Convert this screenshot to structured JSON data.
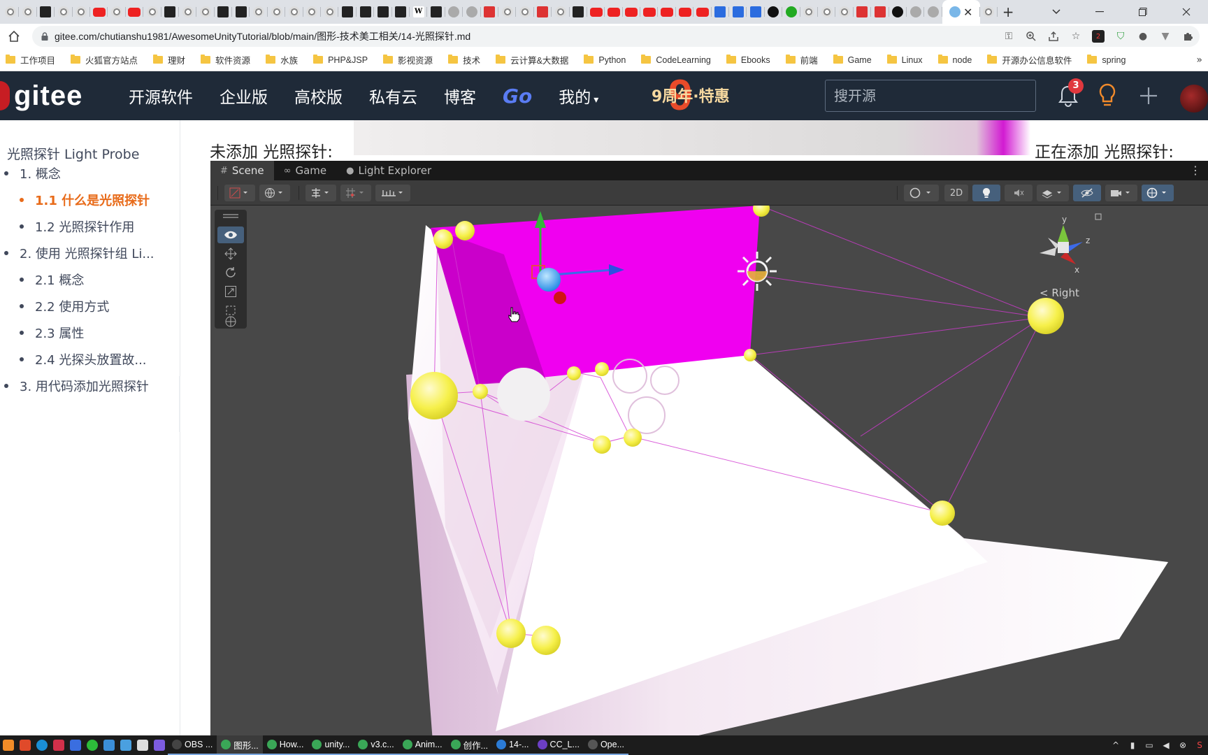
{
  "browser": {
    "active_tab_close": "✕",
    "new_tab": "+",
    "url": "gitee.com/chutianshu1981/AwesomeUnityTutorial/blob/main/图形-技术美工相关/14-光照探针.md",
    "tab_favicons": [
      "chrome",
      "chrome",
      "unity",
      "chrome",
      "chrome",
      "yt",
      "chrome",
      "yt",
      "chrome",
      "unity",
      "chrome",
      "chrome",
      "unity",
      "unity",
      "chrome",
      "chrome",
      "chrome",
      "chrome",
      "chrome",
      "unity",
      "unity",
      "unity",
      "unity",
      "w",
      "unity",
      "plain",
      "plain",
      "red",
      "chrome",
      "chrome",
      "red",
      "chrome",
      "unity",
      "yt",
      "yt",
      "yt",
      "yt",
      "yt",
      "yt",
      "yt",
      "blue",
      "blue",
      "blue",
      "gh",
      "green",
      "chrome",
      "chrome",
      "chrome",
      "red",
      "red",
      "gh",
      "plain",
      "plain"
    ],
    "bookmarks": [
      "工作项目",
      "火狐官方站点",
      "理财",
      "软件资源",
      "水族",
      "PHP&JSP",
      "影视资源",
      "技术",
      "云计算&大数据",
      "Python",
      "CodeLearning",
      "Ebooks",
      "前端",
      "Game",
      "Linux",
      "node",
      "开源办公信息软件",
      "spring"
    ],
    "bookmarks_more": "»"
  },
  "gitee": {
    "logo": "gitee",
    "nav": [
      {
        "label": "开源软件"
      },
      {
        "label": "企业版"
      },
      {
        "label": "高校版"
      },
      {
        "label": "私有云"
      },
      {
        "label": "博客"
      },
      {
        "label": "Go"
      },
      {
        "label": "我的"
      }
    ],
    "promo_text": "9周年·特惠",
    "promo_num": "9",
    "search_placeholder": "搜开源",
    "notifications_count": "3"
  },
  "toc": {
    "title": "光照探针 Light Probe",
    "items": [
      {
        "label": "1. 概念",
        "level": 1
      },
      {
        "label": "1.1 什么是光照探针",
        "level": 2,
        "active": true
      },
      {
        "label": "1.2 光照探针作用",
        "level": 2
      },
      {
        "label": "2. 使用 光照探针组 Li...",
        "level": 1
      },
      {
        "label": "2.1 概念",
        "level": 2
      },
      {
        "label": "2.2 使用方式",
        "level": 2
      },
      {
        "label": "2.3 属性",
        "level": 2
      },
      {
        "label": "2.4 光探头放置故...",
        "level": 2
      },
      {
        "label": "3. 用代码添加光照探针",
        "level": 1
      }
    ],
    "collapse": "‹"
  },
  "content": {
    "caption_left": "未添加 光照探针:",
    "caption_right": "正在添加 光照探针:"
  },
  "unity": {
    "tabs": [
      {
        "label": "Scene",
        "icon": "#"
      },
      {
        "label": "Game",
        "icon": "∞"
      },
      {
        "label": "Light Explorer",
        "icon": "●"
      }
    ],
    "kebab": "⋮",
    "btn_2d": "2D",
    "gizmo_label": "< Right",
    "axis_y": "y",
    "axis_z": "z",
    "axis_x": "x"
  },
  "taskbar": {
    "windows": [
      {
        "label": "OBS ...",
        "color": "#444"
      },
      {
        "label": "图形...",
        "color": "#3aa757",
        "active": true
      },
      {
        "label": "How...",
        "color": "#3aa757"
      },
      {
        "label": "unity...",
        "color": "#3aa757"
      },
      {
        "label": "v3.c...",
        "color": "#3aa757"
      },
      {
        "label": "Anim...",
        "color": "#3aa757"
      },
      {
        "label": "创作...",
        "color": "#3aa757"
      },
      {
        "label": "14-...",
        "color": "#2b7bd6"
      },
      {
        "label": "CC_L...",
        "color": "#6c3fc5"
      },
      {
        "label": "Ope...",
        "color": "#555"
      }
    ]
  }
}
